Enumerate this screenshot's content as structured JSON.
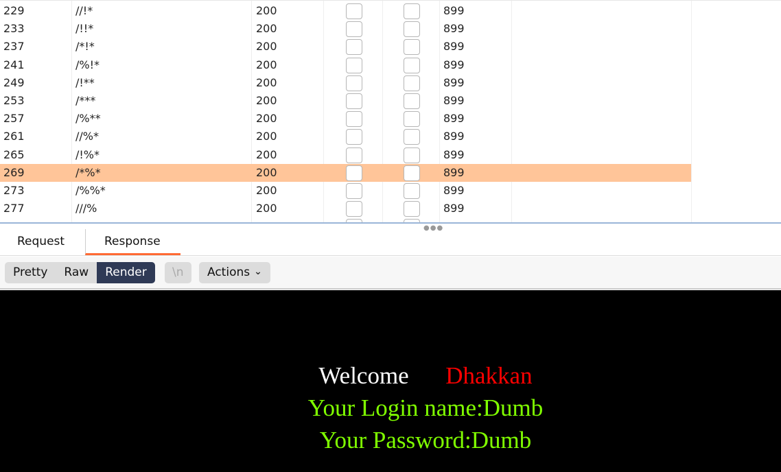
{
  "table": {
    "rows": [
      {
        "id": "229",
        "payload": "//!*",
        "status": "200",
        "length": "899"
      },
      {
        "id": "233",
        "payload": "/!!*",
        "status": "200",
        "length": "899"
      },
      {
        "id": "237",
        "payload": "/*!*",
        "status": "200",
        "length": "899"
      },
      {
        "id": "241",
        "payload": "/%!*",
        "status": "200",
        "length": "899"
      },
      {
        "id": "249",
        "payload": "/!**",
        "status": "200",
        "length": "899"
      },
      {
        "id": "253",
        "payload": "/***",
        "status": "200",
        "length": "899"
      },
      {
        "id": "257",
        "payload": "/%**",
        "status": "200",
        "length": "899"
      },
      {
        "id": "261",
        "payload": "//%*",
        "status": "200",
        "length": "899"
      },
      {
        "id": "265",
        "payload": "/!%*",
        "status": "200",
        "length": "899"
      },
      {
        "id": "269",
        "payload": "/*%*",
        "status": "200",
        "length": "899",
        "selected": true
      },
      {
        "id": "273",
        "payload": "/%%*",
        "status": "200",
        "length": "899"
      },
      {
        "id": "277",
        "payload": "///%",
        "status": "200",
        "length": "899"
      }
    ],
    "selected_color": "#ffc599"
  },
  "tabs": {
    "request": "Request",
    "response": "Response",
    "active": "Response"
  },
  "toolbar": {
    "pretty": "Pretty",
    "raw": "Raw",
    "render": "Render",
    "newline": "\\n",
    "actions": "Actions",
    "active": "Render"
  },
  "render": {
    "welcome": "Welcome",
    "name": "Dhakkan",
    "login": "Your Login name:Dumb",
    "password": "Your Password:Dumb",
    "colors": {
      "welcome": "#ffffff",
      "name": "#ff0000",
      "info": "#80ff00"
    }
  }
}
